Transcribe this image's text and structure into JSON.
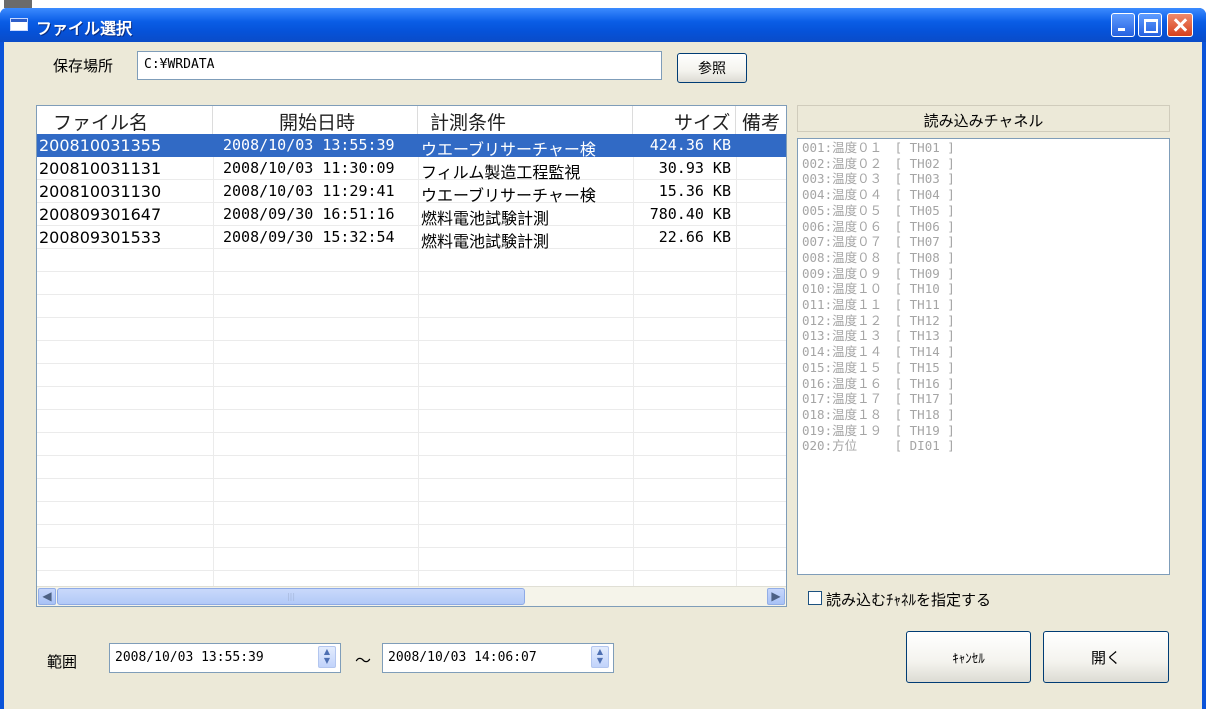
{
  "window": {
    "title": "ファイル選択"
  },
  "location": {
    "label": "保存場所",
    "path": "C:¥WRDATA",
    "browse_label": "参照"
  },
  "file_list": {
    "columns": [
      "ファイル名",
      "開始日時",
      "計測条件",
      "サイズ",
      "備考"
    ],
    "rows": [
      {
        "name": "200810031355",
        "start": "2008/10/03 13:55:39",
        "condition": "ウエーブリサーチャー検",
        "size": "424.36 KB",
        "selected": true
      },
      {
        "name": "200810031131",
        "start": "2008/10/03 11:30:09",
        "condition": "フィルム製造工程監視",
        "size": "30.93 KB",
        "selected": false
      },
      {
        "name": "200810031130",
        "start": "2008/10/03 11:29:41",
        "condition": "ウエーブリサーチャー検",
        "size": "15.36 KB",
        "selected": false
      },
      {
        "name": "200809301647",
        "start": "2008/09/30 16:51:16",
        "condition": "燃料電池試験計測",
        "size": "780.40 KB",
        "selected": false
      },
      {
        "name": "200809301533",
        "start": "2008/09/30 15:32:54",
        "condition": "燃料電池試験計測",
        "size": "22.66 KB",
        "selected": false
      }
    ]
  },
  "channels": {
    "header": "読み込みチャネル",
    "items": [
      "001:温度０１　[ TH01 ]",
      "002:温度０２　[ TH02 ]",
      "003:温度０３　[ TH03 ]",
      "004:温度０４　[ TH04 ]",
      "005:温度０５　[ TH05 ]",
      "006:温度０６　[ TH06 ]",
      "007:温度０７　[ TH07 ]",
      "008:温度０８　[ TH08 ]",
      "009:温度０９　[ TH09 ]",
      "010:温度１０　[ TH10 ]",
      "011:温度１１　[ TH11 ]",
      "012:温度１２　[ TH12 ]",
      "013:温度１３　[ TH13 ]",
      "014:温度１４　[ TH14 ]",
      "015:温度１５　[ TH15 ]",
      "016:温度１６　[ TH16 ]",
      "017:温度１７　[ TH17 ]",
      "018:温度１８　[ TH18 ]",
      "019:温度１９　[ TH19 ]",
      "020:方位　　　[ DI01 ]"
    ],
    "specify_label": "読み込むﾁｬﾈﾙを指定する",
    "specify_checked": false
  },
  "range": {
    "label": "範囲",
    "from": "2008/10/03 13:55:39",
    "separator": "～",
    "to": "2008/10/03 14:06:07"
  },
  "actions": {
    "cancel_label": "ｷｬﾝｾﾙ",
    "open_label": "開く"
  },
  "colors": {
    "selection": "#316ac5",
    "titlebar": "#0a5de6",
    "dialog_bg": "#ece9d8"
  },
  "icons": {
    "minimize": "minimize-icon",
    "maximize": "maximize-icon",
    "close": "close-icon"
  }
}
